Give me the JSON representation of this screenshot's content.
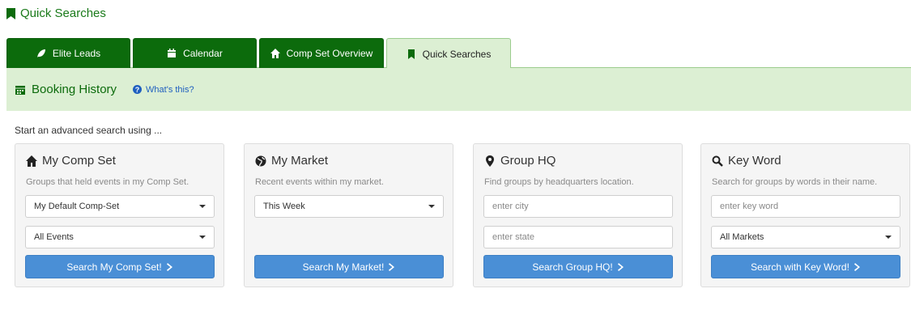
{
  "header": {
    "title": "Quick Searches"
  },
  "tabs": [
    {
      "label": "Elite Leads",
      "icon": "leaf-icon"
    },
    {
      "label": "Calendar",
      "icon": "calendar-icon"
    },
    {
      "label": "Comp Set Overview",
      "icon": "home-icon"
    },
    {
      "label": "Quick Searches",
      "icon": "bookmark-icon",
      "active": true
    }
  ],
  "history": {
    "title": "Booking History",
    "help_label": "What's this?"
  },
  "intro": "Start an advanced search using ...",
  "cards": [
    {
      "title": "My Comp Set",
      "description": "Groups that held events in my Comp Set.",
      "select1": "My Default Comp-Set",
      "select2": "All Events",
      "button": "Search My Comp Set!"
    },
    {
      "title": "My Market",
      "description": "Recent events within my market.",
      "select1": "This Week",
      "button": "Search My Market!"
    },
    {
      "title": "Group HQ",
      "description": "Find groups by headquarters location.",
      "input1_placeholder": "enter city",
      "input2_placeholder": "enter state",
      "button": "Search Group HQ!"
    },
    {
      "title": "Key Word",
      "description": "Search for groups by words in their name.",
      "input1_placeholder": "enter key word",
      "select2": "All Markets",
      "button": "Search with Key Word!"
    }
  ],
  "colors": {
    "brand_green": "#0c6b0c",
    "light_green": "#dcefd3",
    "button_blue": "#4a8fd6",
    "link_blue": "#1f5fbf"
  }
}
